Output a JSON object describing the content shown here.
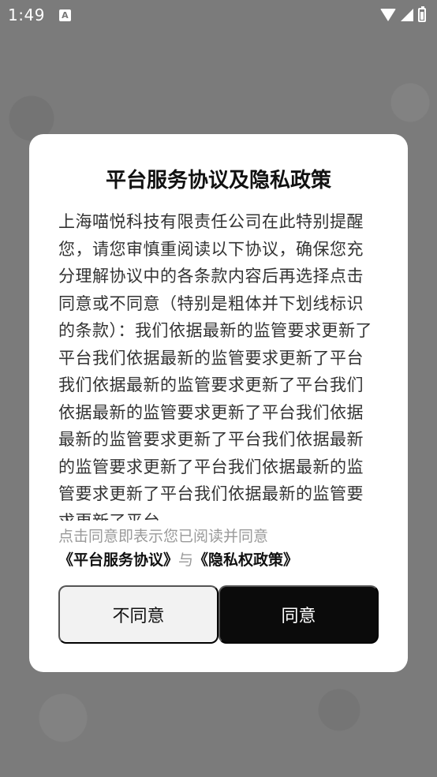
{
  "status_bar": {
    "time": "1:49",
    "notification_icon_label": "A",
    "icons": [
      "wifi-icon",
      "signal-icon",
      "battery-charging-icon"
    ]
  },
  "dialog": {
    "title": "平台服务协议及隐私政策",
    "body": "上海喵悦科技有限责任公司在此特别提醒您，请您审慎重阅读以下协议，确保您充分理解协议中的各条款内容后再选择点击同意或不同意（特别是粗体并下划线标识的条款）：我们依据最新的监管要求更新了平台我们依据最新的监管要求更新了平台我们依据最新的监管要求更新了平台我们依据最新的监管要求更新了平台我们依据最新的监管要求更新了平台我们依据最新的监管要求更新了平台我们依据最新的监管要求更新了平台我们依据最新的监管要求更新了平台",
    "agreement_note": {
      "prefix": "点击同意即表示您已阅读并同意",
      "service_agreement": "《平台服务协议》",
      "conjunction": "与",
      "privacy_policy": "《隐私权政策》"
    },
    "buttons": {
      "disagree": "不同意",
      "agree": "同意"
    }
  },
  "colors": {
    "overlay": "#7b7b7b",
    "dialog_bg": "#ffffff",
    "agree_button": "#0b0b0b",
    "disagree_button": "#f2f2f2"
  }
}
